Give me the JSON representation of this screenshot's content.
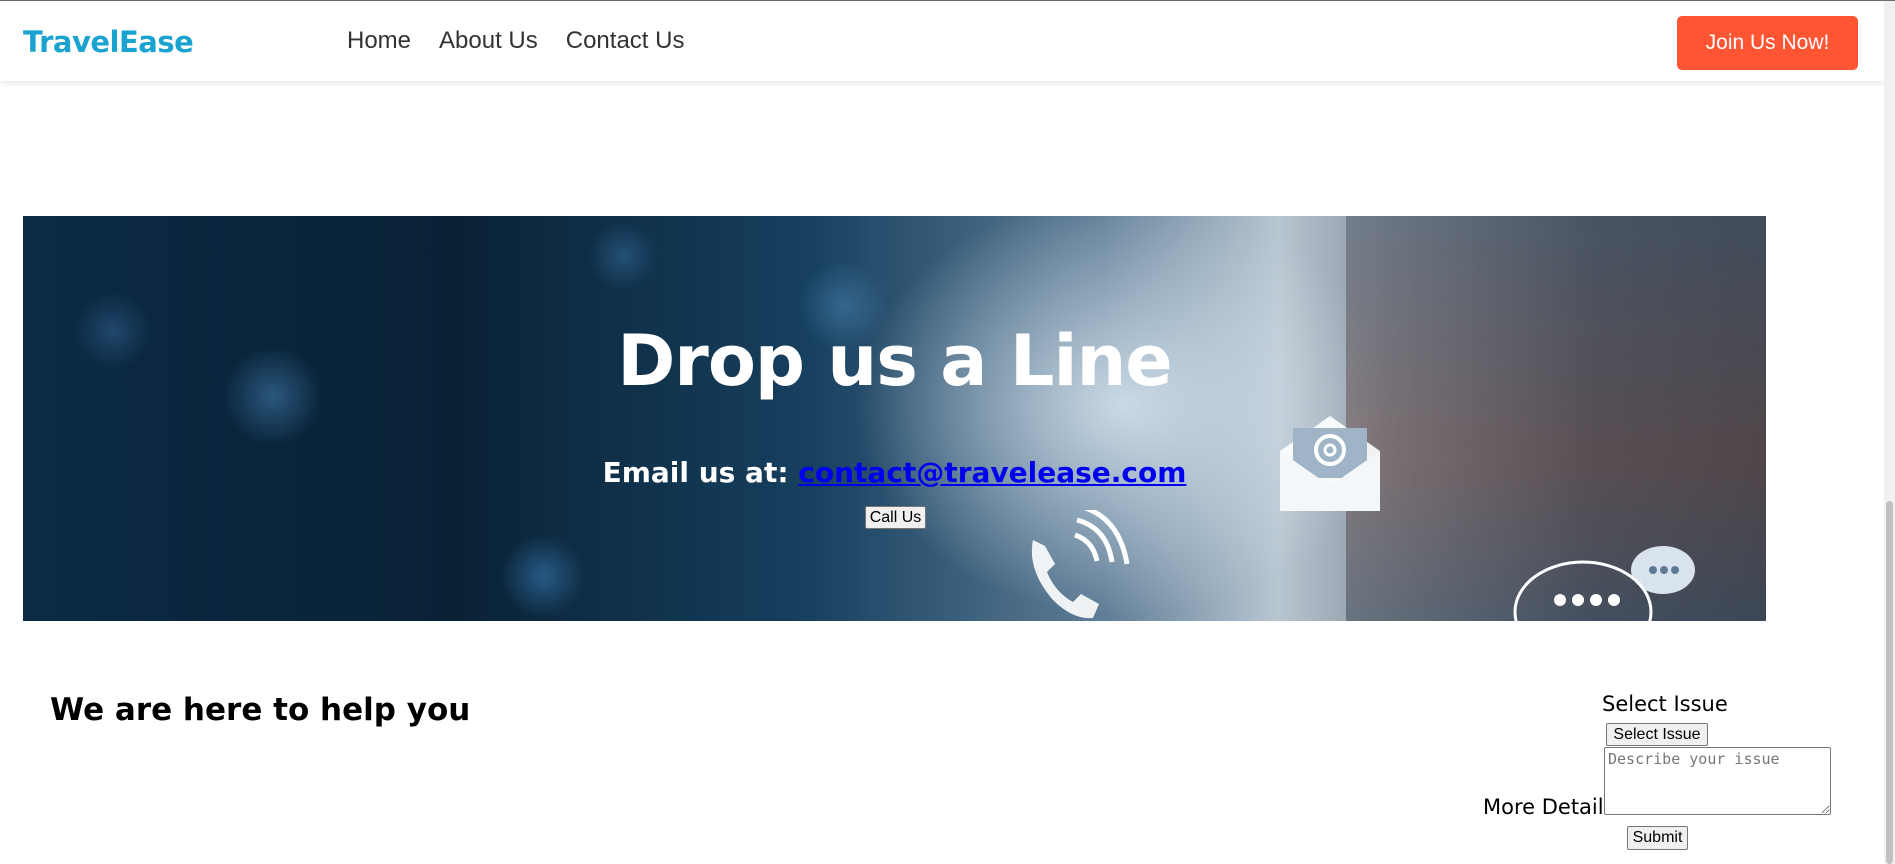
{
  "navbar": {
    "logo": "TravelEase",
    "links": [
      "Home",
      "About Us",
      "Contact Us"
    ],
    "join_label": "Join Us Now!"
  },
  "hero": {
    "title": "Drop us a Line",
    "email_prefix": "Email us at:",
    "email": "contact@travelease.com",
    "call_label": "Call Us"
  },
  "help": {
    "title": "We are here to help you",
    "issue_label": "Select Issue",
    "issue_select_label": "Select Issue",
    "details_label": "More Details",
    "textarea_placeholder": "Describe your issue",
    "submit_label": "Submit"
  },
  "colors": {
    "brand": "#1aa3d1",
    "cta": "#ff5533",
    "link": "#0000ee"
  }
}
